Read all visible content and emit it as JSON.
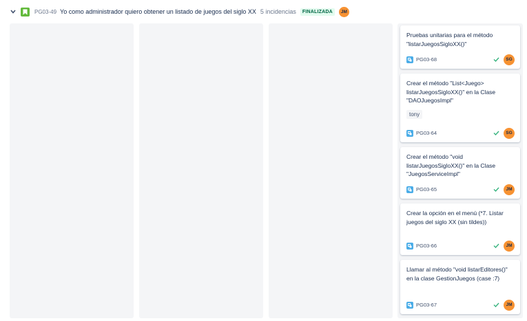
{
  "story": {
    "key": "PG03-49",
    "summary": "Yo como administrador quiero obtener un listado de juegos del siglo XX",
    "count": "5 incidencias",
    "status": "FINALIZADA",
    "assignee": "JM"
  },
  "cards": [
    {
      "title": "Pruebas unitarias para el método \"listarJuegosSigloXX()\"",
      "key": "PG03-68",
      "assignee": "SG"
    },
    {
      "title": "Crear el método \"List<Juego> listarJuegosSigloXX()\" en la Clase \"DAOJuegosImpl\"",
      "label": "tony",
      "key": "PG03-64",
      "assignee": "SG"
    },
    {
      "title": "Crear el método \"void listarJuegosSigloXX()\" en la Clase \"JuegosServiceImpl\"",
      "key": "PG03-65",
      "assignee": "JM"
    },
    {
      "title": "Crear la opción en el menú (*7. Listar juegos del siglo XX (sin tildes))",
      "key": "PG03-66",
      "assignee": "JM"
    },
    {
      "title": "Llamar al método \"void listarEditores()\" en la clase GestionJuegos (case :7)",
      "key": "PG03-67",
      "assignee": "JM"
    }
  ],
  "colors": {
    "story_icon": "#63ba3c",
    "subtask_icon": "#4bade8",
    "avatar": "#f79232",
    "done_check": "#36b37e",
    "column_bg": "#f4f5f7"
  },
  "icons": {
    "collapse": "chevron-down-icon",
    "story": "bookmark-icon",
    "subtask": "subtask-icon",
    "done": "check-icon"
  }
}
